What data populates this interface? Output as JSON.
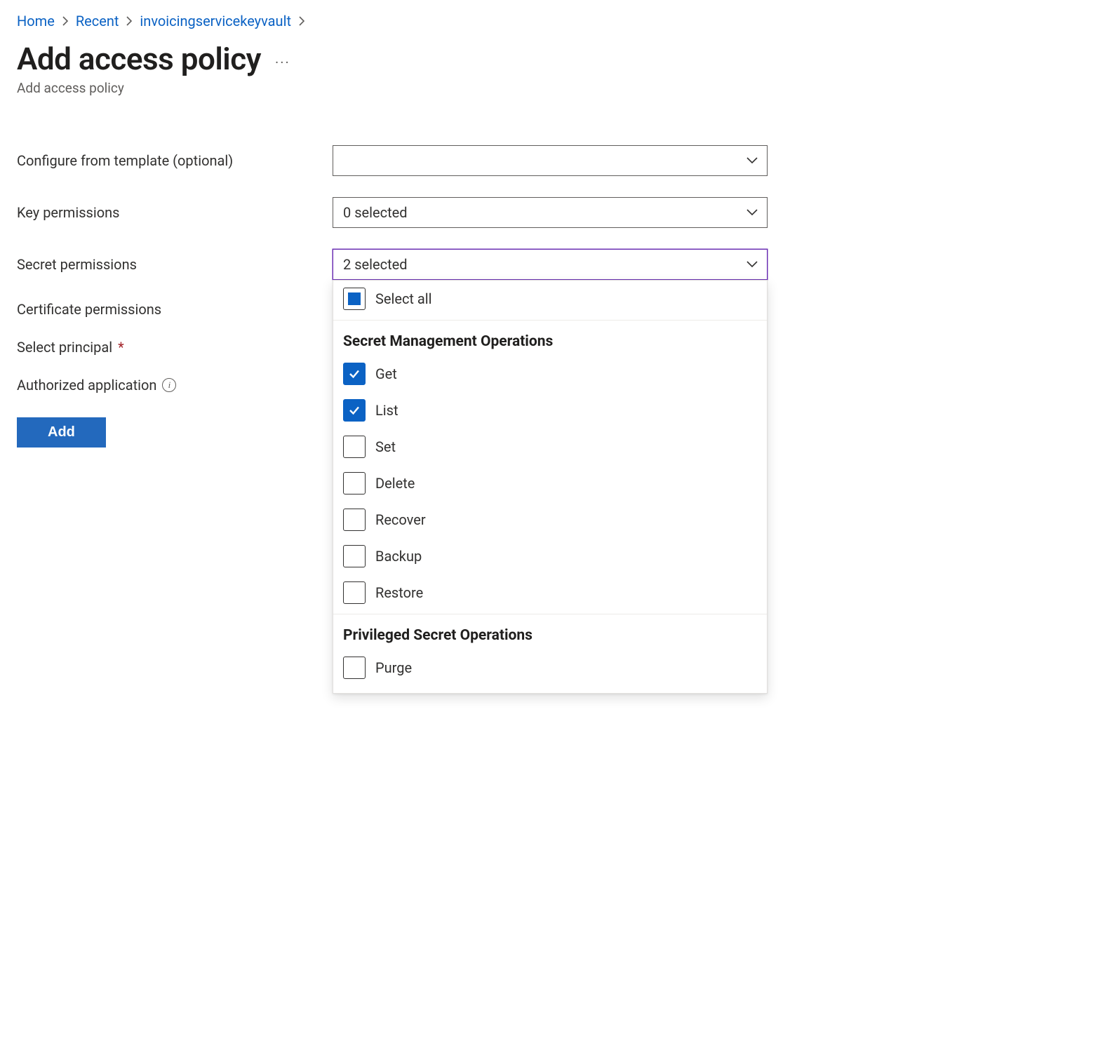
{
  "breadcrumb": {
    "items": [
      {
        "label": "Home"
      },
      {
        "label": "Recent"
      },
      {
        "label": "invoicingservicekeyvault"
      }
    ]
  },
  "header": {
    "title": "Add access policy",
    "subtitle": "Add access policy"
  },
  "form": {
    "template_label": "Configure from template (optional)",
    "template_value": "",
    "key_perms_label": "Key permissions",
    "key_perms_value": "0 selected",
    "secret_perms_label": "Secret permissions",
    "secret_perms_value": "2 selected",
    "cert_perms_label": "Certificate permissions",
    "select_principal_label": "Select principal",
    "auth_app_label": "Authorized application"
  },
  "secret_dropdown": {
    "select_all_label": "Select all",
    "groups": [
      {
        "title": "Secret Management Operations",
        "options": [
          {
            "label": "Get",
            "checked": true
          },
          {
            "label": "List",
            "checked": true
          },
          {
            "label": "Set",
            "checked": false
          },
          {
            "label": "Delete",
            "checked": false
          },
          {
            "label": "Recover",
            "checked": false
          },
          {
            "label": "Backup",
            "checked": false
          },
          {
            "label": "Restore",
            "checked": false
          }
        ]
      },
      {
        "title": "Privileged Secret Operations",
        "options": [
          {
            "label": "Purge",
            "checked": false
          }
        ]
      }
    ]
  },
  "actions": {
    "add_label": "Add"
  },
  "colors": {
    "link": "#0b62c4",
    "primary_button": "#2369bd",
    "focus_border": "#6b2fb3",
    "required": "#a4262c"
  }
}
